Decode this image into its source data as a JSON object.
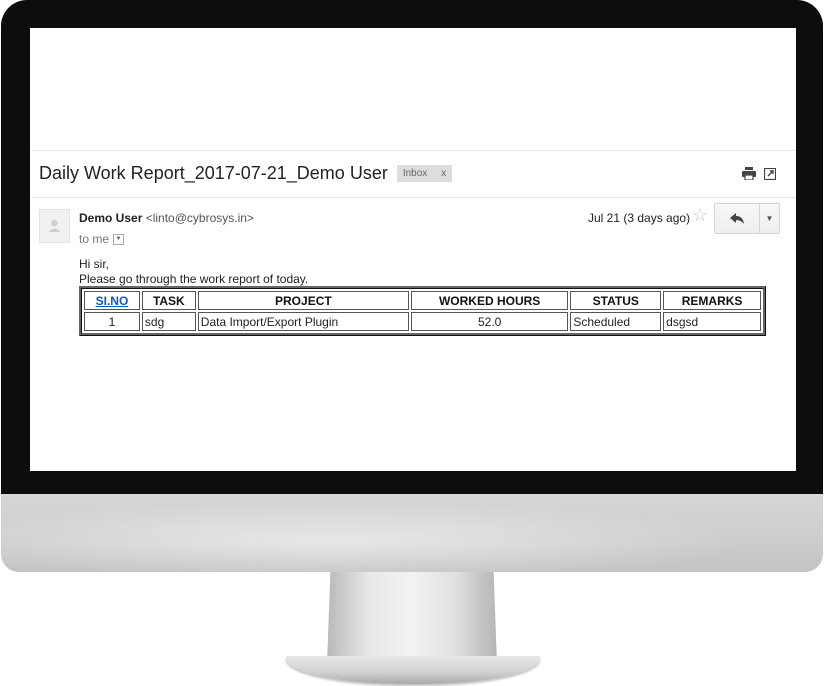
{
  "email": {
    "subject": "Daily Work Report_2017-07-21_Demo User",
    "label": "Inbox",
    "label_remove": "x",
    "sender_name": "Demo User",
    "sender_email": "<linto@cybrosys.in>",
    "recipient": "to me",
    "date": "Jul 21 (3 days ago)",
    "greeting": "Hi sir,",
    "intro": "Please go through the work report of today."
  },
  "table": {
    "headers": [
      "SI.NO",
      "TASK",
      "PROJECT",
      "WORKED HOURS",
      "STATUS",
      "REMARKS"
    ],
    "rows": [
      [
        "1",
        "sdg",
        "Data Import/Export Plugin",
        "52.0",
        "Scheduled",
        "dsgsd"
      ]
    ]
  },
  "icons": {
    "print": "print-icon",
    "new_window": "open-in-new-window-icon",
    "star": "star-icon",
    "reply": "reply-icon",
    "more": "chevron-down-icon",
    "avatar": "default-avatar-icon"
  }
}
